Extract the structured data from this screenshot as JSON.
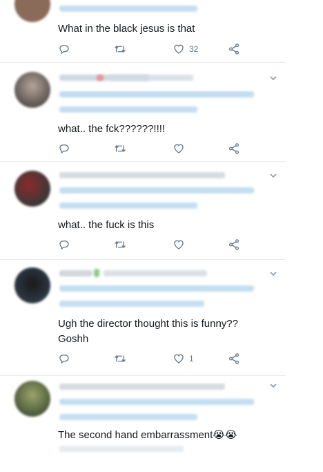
{
  "tweets": [
    {
      "text": "What in the black jesus is that",
      "likes": "32"
    },
    {
      "text": "what.. the fck??????!!!!",
      "likes": ""
    },
    {
      "text": "what.. the fuck is this",
      "likes": ""
    },
    {
      "text": "Ugh the director thought this is funny??",
      "text2": "Goshh",
      "likes": "1"
    },
    {
      "text": "The second hand embarrassment😭😭",
      "likes": ""
    }
  ],
  "icons": [
    "reply-icon",
    "retweet-icon",
    "like-icon",
    "share-icon",
    "chevron-down-icon"
  ]
}
